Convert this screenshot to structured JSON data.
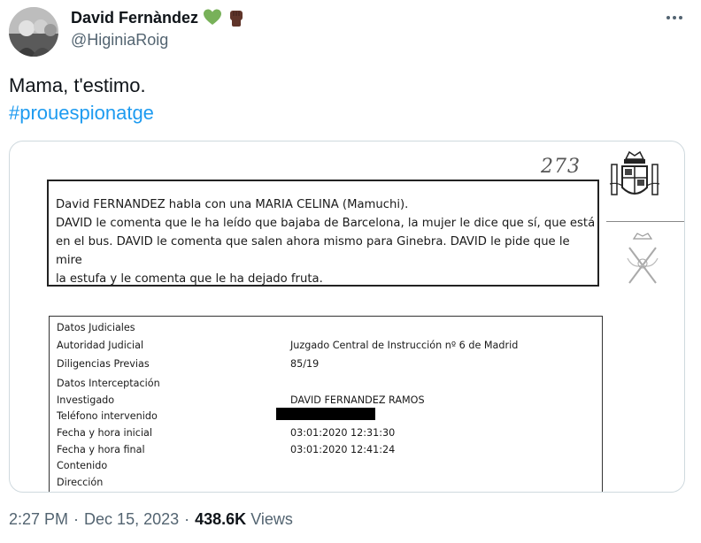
{
  "author": {
    "display_name": "David Fernàndez",
    "handle": "@HiginiaRoig",
    "emojis": [
      "green-heart",
      "raised-fist-dark"
    ]
  },
  "tweet": {
    "text": "Mama, t'estimo.",
    "hashtag": "#prouespionatge"
  },
  "document": {
    "page_number": "273",
    "transcript": {
      "line1": "David FERNANDEZ habla con una MARIA CELINA (Mamuchi).",
      "line2": "DAVID  le comenta que le ha leído que bajaba de Barcelona, la mujer le dice que sí, que está",
      "line3": "en el bus. DAVID le comenta que salen ahora mismo para Ginebra. DAVID le pide que le mire",
      "line4": "la estufa y le comenta que le ha dejado fruta."
    },
    "fields": [
      {
        "label": "Datos Judiciales",
        "value": ""
      },
      {
        "label": "Autoridad Judicial",
        "value": "Juzgado Central de Instrucción nº 6 de Madrid"
      },
      {
        "label": "Diligencias Previas",
        "value": "85/19"
      },
      {
        "label": "Datos Interceptación",
        "value": ""
      },
      {
        "label": "Investigado",
        "value": "DAVID FERNANDEZ RAMOS"
      },
      {
        "label": "Teléfono intervenido",
        "value": ""
      },
      {
        "label": "Fecha y hora inicial",
        "value": "03:01:2020 12:31:30"
      },
      {
        "label": "Fecha y hora final",
        "value": "03:01:2020 12:41:24"
      },
      {
        "label": "Contenido",
        "value": ""
      },
      {
        "label": "Dirección",
        "value": ""
      }
    ]
  },
  "meta": {
    "time": "2:27 PM",
    "separator": "·",
    "date": "Dec 15, 2023",
    "views_count": "438.6K",
    "views_label": "Views"
  },
  "colors": {
    "hashtag": "#1d9bf0",
    "secondary_text": "#536471",
    "card_border": "#cfd9de"
  }
}
